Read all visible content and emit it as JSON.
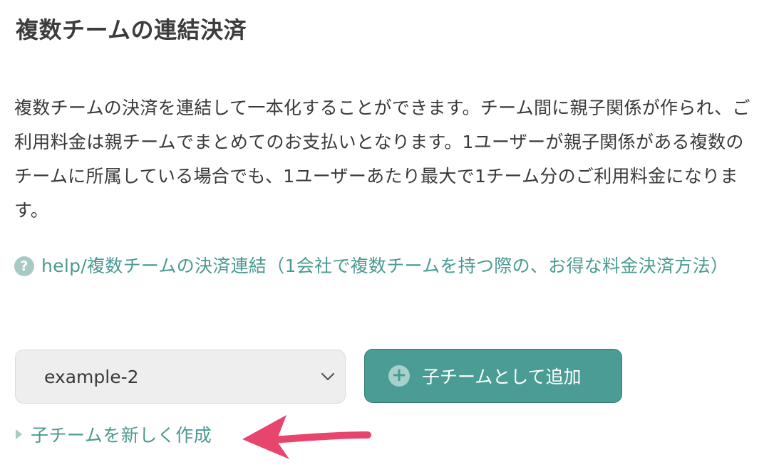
{
  "page": {
    "title": "複数チームの連結決済",
    "description": "複数チームの決済を連結して一本化することができます。チーム間に親子関係が作られ、ご利用料金は親チームでまとめてのお支払いとなります。1ユーザーが親子関係がある複数のチームに所属している場合でも、1ユーザーあたり最大で1チーム分のご利用料金になります。"
  },
  "help": {
    "icon": "question-circle-icon",
    "icon_glyph": "?",
    "link_text": "help/複数チームの決済連結（1会社で複数チームを持つ際の、お得な料金決済方法）"
  },
  "form": {
    "team_select": {
      "value": "example-2",
      "icon": "chevron-down-icon"
    },
    "add_child_button": {
      "icon": "plus-circle-icon",
      "icon_glyph": "+",
      "label": "子チームとして追加"
    },
    "create_new": {
      "icon": "caret-right-icon",
      "label": "子チームを新しく作成"
    }
  },
  "colors": {
    "accent": "#4a9c94",
    "link": "#4a9a91",
    "annotation_arrow": "#e8456e"
  }
}
